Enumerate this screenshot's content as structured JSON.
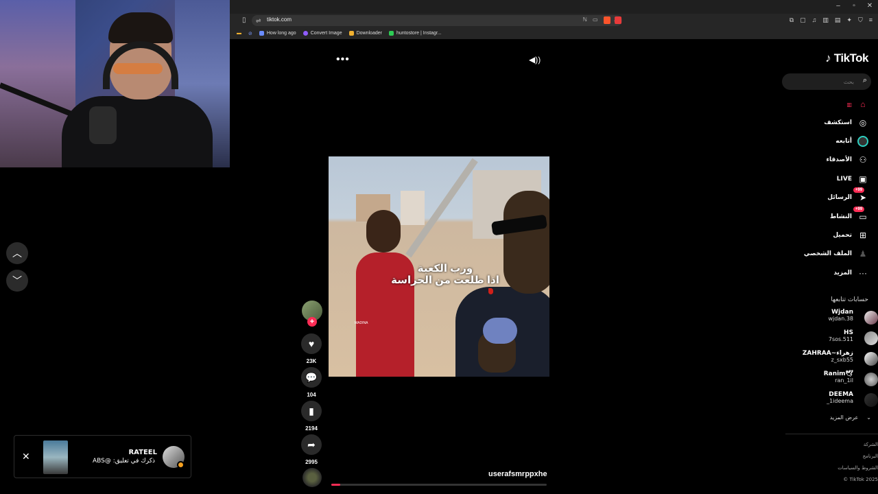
{
  "browser": {
    "url": "tiktok.com",
    "bookmarks": [
      {
        "label": "How long ago",
        "color": "#6a8cff"
      },
      {
        "label": "Convert Image",
        "color": "#8f5cff"
      },
      {
        "label": "Downloader",
        "color": "#f0b030"
      },
      {
        "label": "huntostore | Instagr...",
        "color": "#2ecc55"
      }
    ],
    "window_controls": [
      "–",
      "▫",
      "✕"
    ]
  },
  "video": {
    "caption_line1": "ورب الكعبة",
    "caption_line2": "اذا طلعت من الحراسة",
    "shirt_tag": "MADINA",
    "username": "userafsmrppxhe",
    "progress": 0.04
  },
  "actions": {
    "likes": "23K",
    "comments": "104",
    "saves": "2194",
    "shares": "2995"
  },
  "sidebar": {
    "logo": "TikTok",
    "search_placeholder": "بحث",
    "nav": [
      {
        "label": "",
        "icon": "home-icon",
        "glyph": "⌂",
        "active": true
      },
      {
        "label": "استكشف",
        "icon": "compass-icon",
        "glyph": "◎"
      },
      {
        "label": "أتابعه",
        "icon": "following-avatar-icon",
        "glyph": "●"
      },
      {
        "label": "الأصدقاء",
        "icon": "friends-icon",
        "glyph": "👥"
      },
      {
        "label": "LIVE",
        "icon": "live-icon",
        "glyph": "▣"
      },
      {
        "label": "الرسائل",
        "icon": "messages-icon",
        "glyph": "➤",
        "badge": "+99"
      },
      {
        "label": "النشاط",
        "icon": "activity-icon",
        "glyph": "▭",
        "badge": "+99"
      },
      {
        "label": "تحميل",
        "icon": "upload-icon",
        "glyph": "⊞"
      },
      {
        "label": "الملف الشخصي",
        "icon": "profile-icon",
        "glyph": "♟"
      },
      {
        "label": "المزيد",
        "icon": "more-icon",
        "glyph": "···"
      }
    ],
    "following_header": "حسابات تتابعها",
    "following": [
      {
        "name": "Wjdan",
        "handle": "wjdan.38"
      },
      {
        "name": "HS",
        "handle": "7sos.511"
      },
      {
        "name": "ZAHRAA~زهراء",
        "handle": "z_sxb55"
      },
      {
        "name": "Ranim🕊",
        "handle": "ran_1il"
      },
      {
        "name": "DEEMA",
        "handle": "_1ideema"
      }
    ],
    "see_more": "عرض المزيد",
    "footer": [
      "الشركة",
      "البرنامج",
      "الشروط والسياسات",
      "© TikTok 2025"
    ]
  },
  "notification": {
    "name": "RATEEL",
    "message": "ذكرك في تعليق: @ABS"
  },
  "colors": {
    "accent": "#fe2c55",
    "background": "#000000"
  }
}
